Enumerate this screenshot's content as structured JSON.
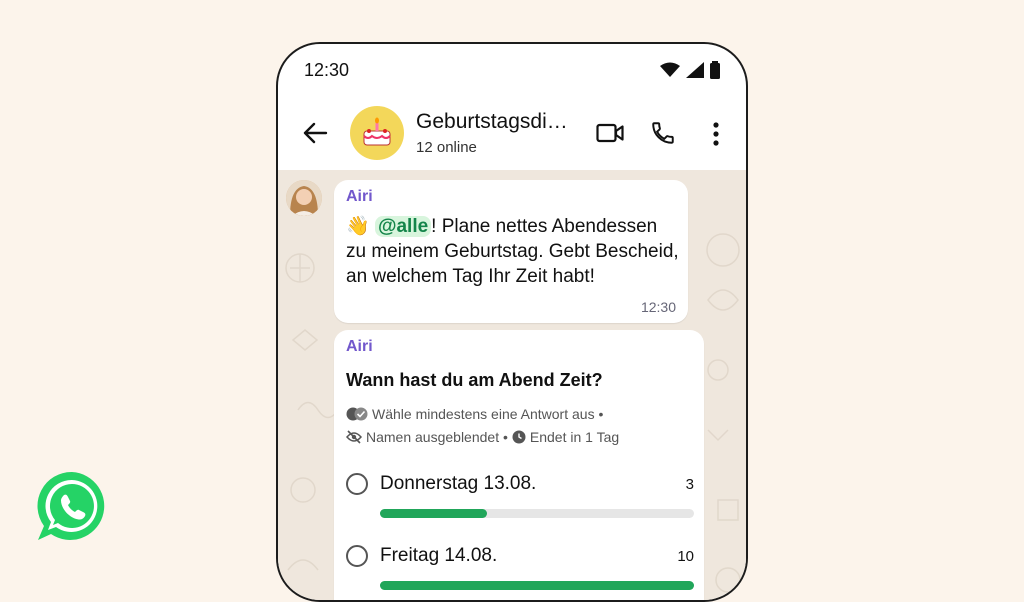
{
  "status": {
    "time": "12:30"
  },
  "header": {
    "title": "Geburtstagsdi…",
    "subtitle": "12 online"
  },
  "message": {
    "sender": "Airi",
    "emoji": "👋",
    "mention": "@alle",
    "text": "! Plane nettes Abendessen zu meinem Geburtstag. Gebt Bescheid, an welchem Tag Ihr Zeit habt!",
    "time": "12:30"
  },
  "poll": {
    "sender": "Airi",
    "question": "Wann hast du am Abend Zeit?",
    "meta1": "Wähle mindestens eine Antwort aus •",
    "meta2a": "Namen ausgeblendet •",
    "meta2b": "Endet in 1 Tag",
    "options": [
      {
        "label": "Donnerstag 13.08.",
        "count": "3",
        "fraction": 0.34
      },
      {
        "label": "Freitag 14.08.",
        "count": "10",
        "fraction": 1.0
      }
    ]
  },
  "colors": {
    "accent": "#21a65a",
    "sender": "#7258cc",
    "background": "#fcf4eb"
  }
}
